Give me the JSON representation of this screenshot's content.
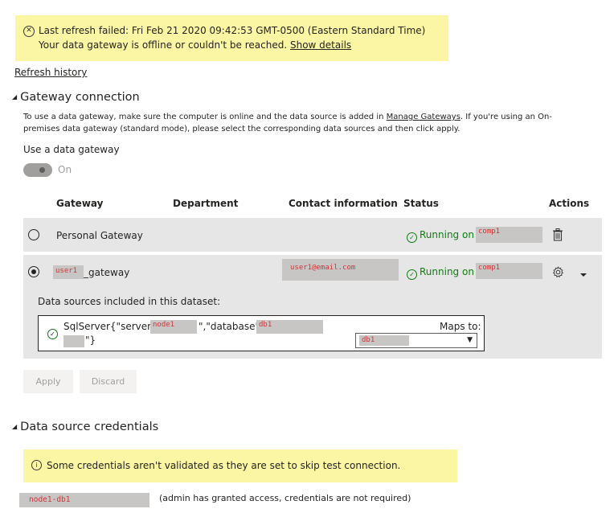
{
  "alert": {
    "icon": "error-circle-icon",
    "line1": "Last refresh failed: Fri Feb 21 2020 09:42:53 GMT-0500 (Eastern Standard Time)",
    "line2_text": "Your data gateway is offline or couldn't be reached.",
    "line2_link": "Show details"
  },
  "refresh_history_label": "Refresh history",
  "gateway_connection": {
    "title": "Gateway connection",
    "desc_part1": "To use a data gateway, make sure the computer is online and the data source is added in",
    "desc_link": "Manage Gateways",
    "desc_part2": ". If you're using an On-premises data gateway (standard mode), please select the corresponding data sources and then click apply.",
    "use_gateway_label": "Use a data gateway",
    "toggle_state": "On",
    "columns": [
      "Gateway",
      "Department",
      "Contact information",
      "Status",
      "Actions"
    ],
    "rows": [
      {
        "selected": false,
        "gateway": "Personal Gateway",
        "status": "Running on",
        "machine": "comp1"
      },
      {
        "selected": true,
        "gateway_user": "user1",
        "gateway_suffix": "_gateway",
        "contact": "user1@email.com",
        "status": "Running on",
        "machine": "comp1"
      }
    ],
    "data_sources_label": "Data sources included in this dataset:",
    "source": {
      "prefix": "SqlServer{\"server\":\"",
      "server": "node1",
      "middle": "\",\"database\":\"",
      "database": "db1",
      "suffix": "\"}",
      "maps_to_label": "Maps to:",
      "maps_to_value": "db1"
    },
    "apply_label": "Apply",
    "discard_label": "Discard"
  },
  "credentials": {
    "title": "Data source credentials",
    "info_text": "Some credentials aren't validated as they are set to skip test connection.",
    "source_name": "node1-db1",
    "source_note": "(admin has granted access, credentials are not required)"
  },
  "colors": {
    "banner_bg": "#fbf6a3",
    "row_bg": "#e6e6e6",
    "success_green": "#107c10",
    "redaction_text": "#d13438"
  }
}
